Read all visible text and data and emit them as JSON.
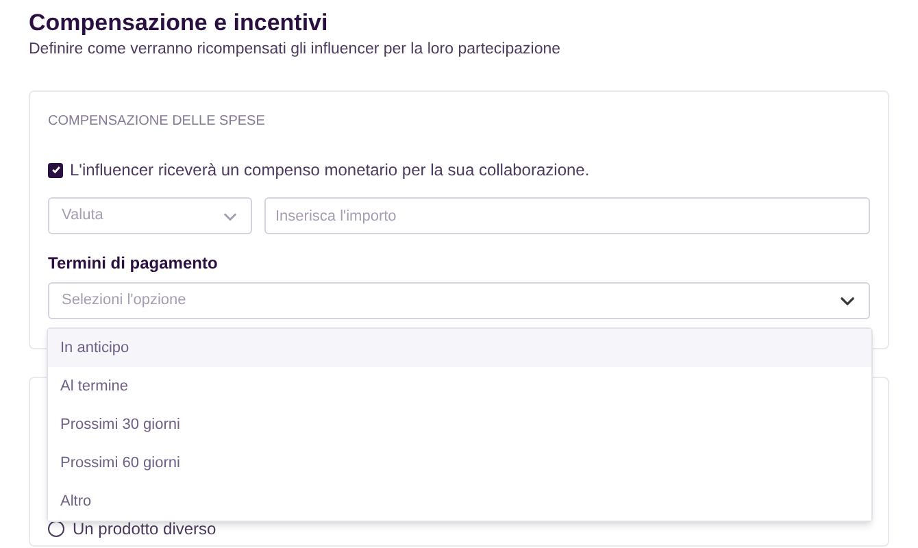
{
  "header": {
    "title": "Compensazione e incentivi",
    "subtitle": "Definire come verranno ricompensati gli influencer per la loro partecipazione"
  },
  "expenses": {
    "heading": "COMPENSAZIONE DELLE SPESE",
    "monetary": {
      "label": "L'influencer riceverà un compenso monetario per la sua collaborazione.",
      "checked": true
    },
    "currency": {
      "placeholder": "Valuta"
    },
    "amount": {
      "placeholder": "Inserisca l'importo"
    },
    "payment_terms": {
      "label": "Termini di pagamento",
      "placeholder": "Selezioni l'opzione",
      "expanded": true,
      "options": [
        {
          "label": "In anticipo",
          "selected": true
        },
        {
          "label": "Al termine",
          "selected": false
        },
        {
          "label": "Prossimi 30 giorni",
          "selected": false
        },
        {
          "label": "Prossimi 60 giorni",
          "selected": false
        },
        {
          "label": "Altro",
          "selected": false
        }
      ]
    }
  },
  "products": {
    "option": {
      "label": "Un prodotto diverso",
      "selected": false
    }
  }
}
